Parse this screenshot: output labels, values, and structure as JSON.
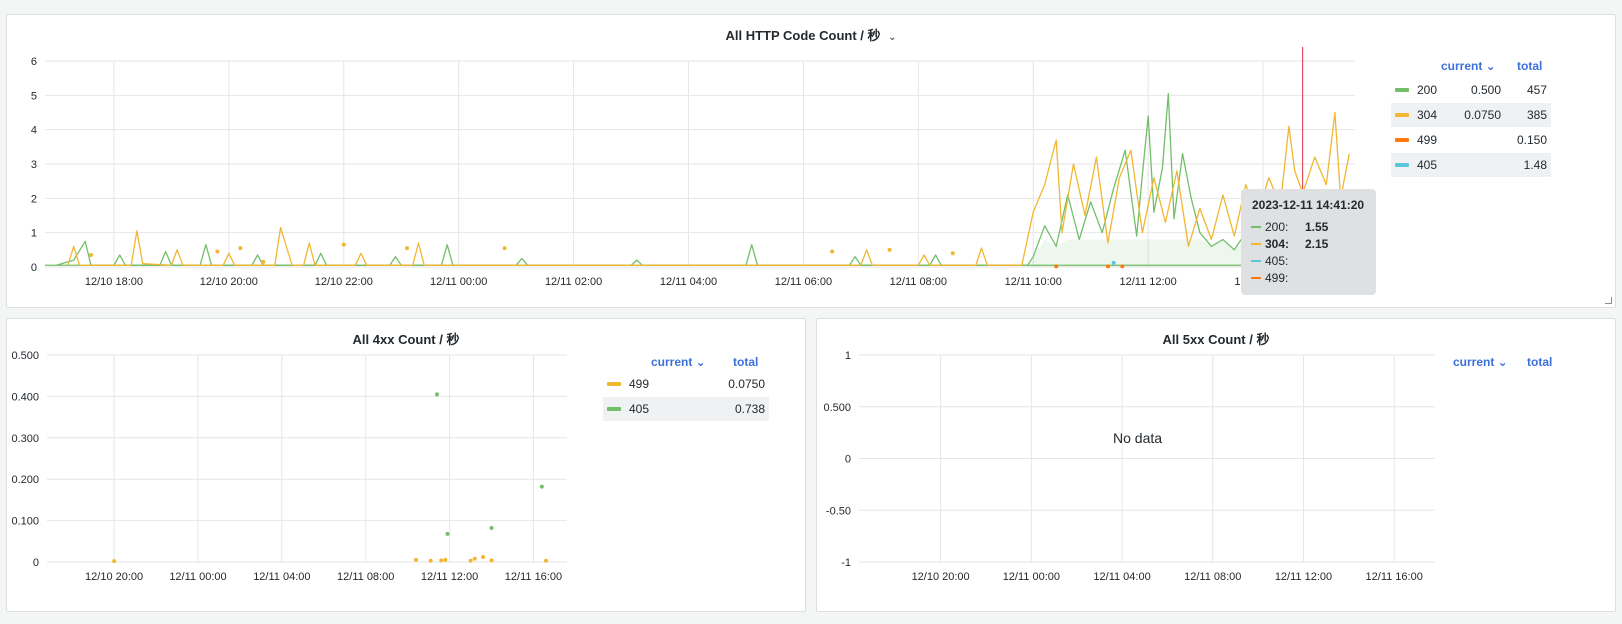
{
  "colors": {
    "green": "#73bf69",
    "yellow": "#f2b630",
    "orange": "#ff780a",
    "cyan": "#5bc6dc",
    "red_marker": "#e02f44",
    "link_blue": "#3d71d9"
  },
  "panels": {
    "top": {
      "title": "All HTTP Code Count / 秒",
      "caret": "⌄",
      "legend": {
        "col_current": "current ⌄",
        "col_total": "total",
        "rows": [
          {
            "name": "200",
            "current": "0.500",
            "total": "457",
            "color": "#73bf69"
          },
          {
            "name": "304",
            "current": "0.0750",
            "total": "385",
            "color": "#f2b630"
          },
          {
            "name": "499",
            "current": "",
            "total": "0.150",
            "color": "#ff780a"
          },
          {
            "name": "405",
            "current": "",
            "total": "1.48",
            "color": "#5bc6dc"
          }
        ]
      },
      "tooltip": {
        "time": "2023-12-11 14:41:20",
        "rows": [
          {
            "name": "200:",
            "value": "1.55",
            "color": "#73bf69"
          },
          {
            "name": "304:",
            "value": "2.15",
            "color": "#f2b630"
          },
          {
            "name": "405:",
            "value": "",
            "color": "#5bc6dc"
          },
          {
            "name": "499:",
            "value": "",
            "color": "#ff780a"
          }
        ]
      }
    },
    "fourxx": {
      "title": "All 4xx Count / 秒",
      "legend": {
        "col_current": "current ⌄",
        "col_total": "total",
        "rows": [
          {
            "name": "499",
            "current": "",
            "total": "0.0750",
            "color": "#f2b630"
          },
          {
            "name": "405",
            "current": "",
            "total": "0.738",
            "color": "#73bf69"
          }
        ]
      }
    },
    "fivexx": {
      "title": "All 5xx Count / 秒",
      "no_data": "No data",
      "legend": {
        "col_current": "current ⌄",
        "col_total": "total"
      }
    }
  },
  "chart_data": [
    {
      "type": "line",
      "title": "All HTTP Code Count / 秒",
      "x_ticks": [
        "12/10 18:00",
        "12/10 20:00",
        "12/10 22:00",
        "12/11 00:00",
        "12/11 02:00",
        "12/11 04:00",
        "12/11 06:00",
        "12/11 08:00",
        "12/11 10:00",
        "12/11 12:00",
        "12/11 14:00"
      ],
      "y_ticks": [
        "0",
        "1",
        "2",
        "3",
        "4",
        "5",
        "6"
      ],
      "ylim": [
        0,
        6
      ],
      "xlim_hours": [
        -7.2,
        15.6
      ],
      "grid": true,
      "legend_position": "right",
      "crosshair_hour": 14.689,
      "series": [
        {
          "name": "200",
          "color": "#73bf69",
          "points": [
            [
              -7.0,
              0.05
            ],
            [
              -6.7,
              0.2
            ],
            [
              -6.5,
              0.75
            ],
            [
              -6.4,
              0.05
            ],
            [
              -6.0,
              0.05
            ],
            [
              -5.9,
              0.35
            ],
            [
              -5.8,
              0.05
            ],
            [
              -5.2,
              0.05
            ],
            [
              -5.1,
              0.45
            ],
            [
              -5.0,
              0.05
            ],
            [
              -4.5,
              0.05
            ],
            [
              -4.4,
              0.65
            ],
            [
              -4.3,
              0.05
            ],
            [
              -3.6,
              0.05
            ],
            [
              -3.5,
              0.35
            ],
            [
              -3.4,
              0.05
            ],
            [
              -2.5,
              0.05
            ],
            [
              -2.4,
              0.4
            ],
            [
              -2.3,
              0.05
            ],
            [
              -1.2,
              0.05
            ],
            [
              -1.1,
              0.3
            ],
            [
              -1.0,
              0.05
            ],
            [
              -0.3,
              0.05
            ],
            [
              -0.2,
              0.65
            ],
            [
              -0.1,
              0.05
            ],
            [
              1.0,
              0.05
            ],
            [
              1.1,
              0.25
            ],
            [
              1.2,
              0.05
            ],
            [
              3.0,
              0.05
            ],
            [
              3.1,
              0.2
            ],
            [
              3.2,
              0.05
            ],
            [
              5.0,
              0.05
            ],
            [
              5.1,
              0.65
            ],
            [
              5.2,
              0.05
            ],
            [
              6.8,
              0.05
            ],
            [
              6.9,
              0.3
            ],
            [
              7.0,
              0.05
            ],
            [
              8.2,
              0.05
            ],
            [
              8.3,
              0.35
            ],
            [
              8.4,
              0.05
            ],
            [
              9.9,
              0.05
            ],
            [
              10.0,
              0.3
            ],
            [
              10.2,
              1.2
            ],
            [
              10.4,
              0.6
            ],
            [
              10.6,
              2.1
            ],
            [
              10.8,
              0.8
            ],
            [
              11.0,
              1.9
            ],
            [
              11.2,
              1.0
            ],
            [
              11.4,
              2.3
            ],
            [
              11.6,
              3.4
            ],
            [
              11.8,
              0.9
            ],
            [
              11.9,
              2.7
            ],
            [
              12.0,
              4.4
            ],
            [
              12.1,
              1.6
            ],
            [
              12.25,
              2.9
            ],
            [
              12.35,
              5.05
            ],
            [
              12.45,
              1.4
            ],
            [
              12.6,
              3.3
            ],
            [
              12.75,
              2.0
            ],
            [
              12.9,
              1.0
            ],
            [
              13.1,
              0.6
            ],
            [
              13.3,
              0.8
            ],
            [
              13.5,
              0.5
            ],
            [
              13.7,
              1.0
            ],
            [
              13.9,
              0.6
            ],
            [
              14.1,
              1.4
            ],
            [
              14.3,
              0.9
            ],
            [
              14.5,
              1.8
            ],
            [
              14.69,
              1.55
            ],
            [
              14.9,
              0.9
            ],
            [
              15.1,
              1.4
            ],
            [
              15.3,
              0.7
            ],
            [
              15.5,
              0.4
            ]
          ]
        },
        {
          "name": "304",
          "color": "#f2b630",
          "points": [
            [
              -6.8,
              0.05
            ],
            [
              -6.7,
              0.6
            ],
            [
              -6.6,
              0.05
            ],
            [
              -5.7,
              0.05
            ],
            [
              -5.6,
              1.05
            ],
            [
              -5.5,
              0.1
            ],
            [
              -5.0,
              0.05
            ],
            [
              -4.9,
              0.5
            ],
            [
              -4.8,
              0.05
            ],
            [
              -4.1,
              0.05
            ],
            [
              -4.0,
              0.4
            ],
            [
              -3.9,
              0.05
            ],
            [
              -3.2,
              0.05
            ],
            [
              -3.1,
              1.15
            ],
            [
              -3.0,
              0.6
            ],
            [
              -2.9,
              0.05
            ],
            [
              -2.7,
              0.05
            ],
            [
              -2.6,
              0.7
            ],
            [
              -2.5,
              0.05
            ],
            [
              -1.8,
              0.05
            ],
            [
              -1.7,
              0.4
            ],
            [
              -1.6,
              0.05
            ],
            [
              -0.8,
              0.05
            ],
            [
              -0.7,
              0.7
            ],
            [
              -0.6,
              0.05
            ],
            [
              7.0,
              0.05
            ],
            [
              7.1,
              0.5
            ],
            [
              7.2,
              0.05
            ],
            [
              8.0,
              0.05
            ],
            [
              8.1,
              0.35
            ],
            [
              8.2,
              0.05
            ],
            [
              9.0,
              0.05
            ],
            [
              9.1,
              0.55
            ],
            [
              9.2,
              0.05
            ],
            [
              9.8,
              0.05
            ],
            [
              10.0,
              1.6
            ],
            [
              10.2,
              2.4
            ],
            [
              10.4,
              3.7
            ],
            [
              10.5,
              1.0
            ],
            [
              10.7,
              3.0
            ],
            [
              10.9,
              1.5
            ],
            [
              11.1,
              3.2
            ],
            [
              11.3,
              0.7
            ],
            [
              11.5,
              2.6
            ],
            [
              11.7,
              3.4
            ],
            [
              11.9,
              1.0
            ],
            [
              12.1,
              2.6
            ],
            [
              12.3,
              1.3
            ],
            [
              12.5,
              2.8
            ],
            [
              12.7,
              0.6
            ],
            [
              12.9,
              1.7
            ],
            [
              13.1,
              0.8
            ],
            [
              13.3,
              2.1
            ],
            [
              13.5,
              0.9
            ],
            [
              13.7,
              2.4
            ],
            [
              13.9,
              1.5
            ],
            [
              14.1,
              2.6
            ],
            [
              14.3,
              1.8
            ],
            [
              14.45,
              4.1
            ],
            [
              14.55,
              2.8
            ],
            [
              14.69,
              2.15
            ],
            [
              14.9,
              3.2
            ],
            [
              15.1,
              2.4
            ],
            [
              15.25,
              4.5
            ],
            [
              15.35,
              2.0
            ],
            [
              15.5,
              3.3
            ]
          ]
        }
      ],
      "points": [
        {
          "series": "304",
          "x": -6.4,
          "y": 0.35
        },
        {
          "series": "304",
          "x": -4.2,
          "y": 0.45
        },
        {
          "series": "304",
          "x": -3.8,
          "y": 0.55
        },
        {
          "series": "304",
          "x": -3.4,
          "y": 0.15
        },
        {
          "series": "304",
          "x": -2.0,
          "y": 0.65
        },
        {
          "series": "304",
          "x": -0.9,
          "y": 0.55
        },
        {
          "series": "304",
          "x": 0.8,
          "y": 0.55
        },
        {
          "series": "304",
          "x": 6.5,
          "y": 0.45
        },
        {
          "series": "304",
          "x": 7.5,
          "y": 0.5
        },
        {
          "series": "304",
          "x": 8.6,
          "y": 0.4
        },
        {
          "series": "499",
          "x": 10.4,
          "y": 0.02
        },
        {
          "series": "499",
          "x": 11.3,
          "y": 0.02
        },
        {
          "series": "499",
          "x": 11.55,
          "y": 0.02
        },
        {
          "series": "405",
          "x": 11.4,
          "y": 0.12
        },
        {
          "series": "405",
          "x": 14.6,
          "y": 0.12
        }
      ]
    },
    {
      "type": "scatter",
      "title": "All 4xx Count / 秒",
      "x_ticks": [
        "12/10 20:00",
        "12/11 00:00",
        "12/11 04:00",
        "12/11 08:00",
        "12/11 12:00",
        "12/11 16:00"
      ],
      "y_ticks": [
        "0",
        "0.100",
        "0.200",
        "0.300",
        "0.400",
        "0.500"
      ],
      "ylim": [
        0,
        0.5
      ],
      "xlim_hours": [
        -7.2,
        17.6
      ],
      "grid": true,
      "legend_position": "right",
      "series": [
        {
          "name": "499",
          "color": "#f2b630",
          "points": [
            [
              -4.0,
              0.002
            ],
            [
              10.4,
              0.005
            ],
            [
              11.1,
              0.003
            ],
            [
              11.6,
              0.004
            ],
            [
              11.8,
              0.005
            ],
            [
              13.0,
              0.003
            ],
            [
              13.2,
              0.008
            ],
            [
              13.6,
              0.012
            ],
            [
              14.0,
              0.004
            ],
            [
              16.6,
              0.003
            ]
          ]
        },
        {
          "name": "405",
          "color": "#73bf69",
          "points": [
            [
              11.4,
              0.405
            ],
            [
              11.9,
              0.068
            ],
            [
              14.0,
              0.082
            ],
            [
              16.4,
              0.182
            ]
          ]
        }
      ]
    },
    {
      "type": "line",
      "title": "All 5xx Count / 秒",
      "x_ticks": [
        "12/10 20:00",
        "12/11 00:00",
        "12/11 04:00",
        "12/11 08:00",
        "12/11 12:00",
        "12/11 16:00"
      ],
      "y_ticks": [
        "-1",
        "-0.50",
        "0",
        "0.500",
        "1"
      ],
      "ylim": [
        -1,
        1
      ],
      "xlim_hours": [
        -7.6,
        17.8
      ],
      "grid": true,
      "legend_position": "right",
      "series": []
    }
  ]
}
